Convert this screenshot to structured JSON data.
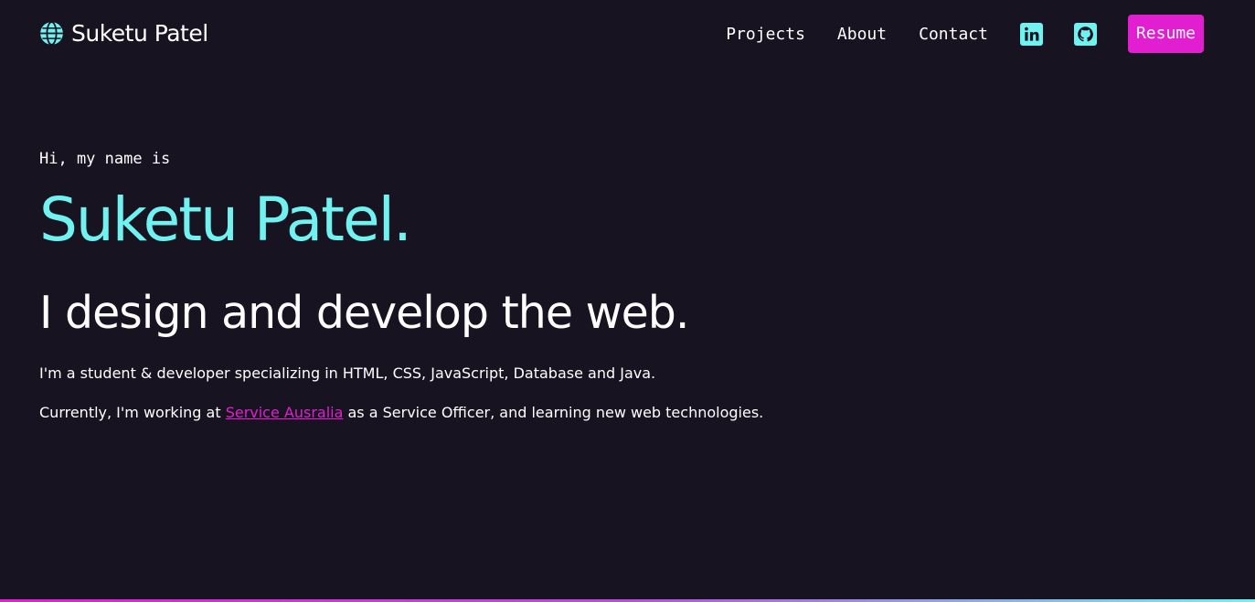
{
  "header": {
    "brand_name": "Suketu Patel",
    "brand_icon": "globe-icon",
    "nav": {
      "projects": "Projects",
      "about": "About",
      "contact": "Contact"
    },
    "social_icons": [
      "linkedin-icon",
      "github-icon"
    ],
    "resume_label": "Resume"
  },
  "hero": {
    "greeting": "Hi, my name is",
    "name": "Suketu Patel.",
    "tagline": "I design and develop the web.",
    "description_1": "I'm a student & developer specializing in HTML, CSS, JavaScript, Database and Java.",
    "description_2_prefix": "Currently, I'm working at ",
    "description_2_link": "Service Ausralia",
    "description_2_suffix": " as a Service Officer, and learning new web technologies."
  },
  "colors": {
    "background": "#181321",
    "accent_cyan": "#6ff2f0",
    "accent_magenta": "#e11fd1",
    "text": "#ffffff"
  }
}
